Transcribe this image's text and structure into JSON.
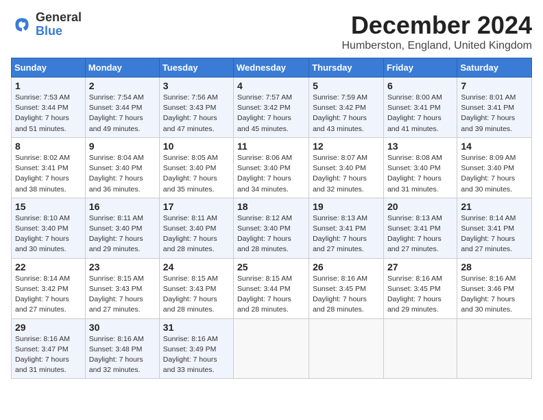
{
  "logo": {
    "general": "General",
    "blue": "Blue"
  },
  "header": {
    "month": "December 2024",
    "location": "Humberston, England, United Kingdom"
  },
  "weekdays": [
    "Sunday",
    "Monday",
    "Tuesday",
    "Wednesday",
    "Thursday",
    "Friday",
    "Saturday"
  ],
  "weeks": [
    [
      {
        "day": "1",
        "sunrise": "Sunrise: 7:53 AM",
        "sunset": "Sunset: 3:44 PM",
        "daylight": "Daylight: 7 hours and 51 minutes."
      },
      {
        "day": "2",
        "sunrise": "Sunrise: 7:54 AM",
        "sunset": "Sunset: 3:44 PM",
        "daylight": "Daylight: 7 hours and 49 minutes."
      },
      {
        "day": "3",
        "sunrise": "Sunrise: 7:56 AM",
        "sunset": "Sunset: 3:43 PM",
        "daylight": "Daylight: 7 hours and 47 minutes."
      },
      {
        "day": "4",
        "sunrise": "Sunrise: 7:57 AM",
        "sunset": "Sunset: 3:42 PM",
        "daylight": "Daylight: 7 hours and 45 minutes."
      },
      {
        "day": "5",
        "sunrise": "Sunrise: 7:59 AM",
        "sunset": "Sunset: 3:42 PM",
        "daylight": "Daylight: 7 hours and 43 minutes."
      },
      {
        "day": "6",
        "sunrise": "Sunrise: 8:00 AM",
        "sunset": "Sunset: 3:41 PM",
        "daylight": "Daylight: 7 hours and 41 minutes."
      },
      {
        "day": "7",
        "sunrise": "Sunrise: 8:01 AM",
        "sunset": "Sunset: 3:41 PM",
        "daylight": "Daylight: 7 hours and 39 minutes."
      }
    ],
    [
      {
        "day": "8",
        "sunrise": "Sunrise: 8:02 AM",
        "sunset": "Sunset: 3:41 PM",
        "daylight": "Daylight: 7 hours and 38 minutes."
      },
      {
        "day": "9",
        "sunrise": "Sunrise: 8:04 AM",
        "sunset": "Sunset: 3:40 PM",
        "daylight": "Daylight: 7 hours and 36 minutes."
      },
      {
        "day": "10",
        "sunrise": "Sunrise: 8:05 AM",
        "sunset": "Sunset: 3:40 PM",
        "daylight": "Daylight: 7 hours and 35 minutes."
      },
      {
        "day": "11",
        "sunrise": "Sunrise: 8:06 AM",
        "sunset": "Sunset: 3:40 PM",
        "daylight": "Daylight: 7 hours and 34 minutes."
      },
      {
        "day": "12",
        "sunrise": "Sunrise: 8:07 AM",
        "sunset": "Sunset: 3:40 PM",
        "daylight": "Daylight: 7 hours and 32 minutes."
      },
      {
        "day": "13",
        "sunrise": "Sunrise: 8:08 AM",
        "sunset": "Sunset: 3:40 PM",
        "daylight": "Daylight: 7 hours and 31 minutes."
      },
      {
        "day": "14",
        "sunrise": "Sunrise: 8:09 AM",
        "sunset": "Sunset: 3:40 PM",
        "daylight": "Daylight: 7 hours and 30 minutes."
      }
    ],
    [
      {
        "day": "15",
        "sunrise": "Sunrise: 8:10 AM",
        "sunset": "Sunset: 3:40 PM",
        "daylight": "Daylight: 7 hours and 30 minutes."
      },
      {
        "day": "16",
        "sunrise": "Sunrise: 8:11 AM",
        "sunset": "Sunset: 3:40 PM",
        "daylight": "Daylight: 7 hours and 29 minutes."
      },
      {
        "day": "17",
        "sunrise": "Sunrise: 8:11 AM",
        "sunset": "Sunset: 3:40 PM",
        "daylight": "Daylight: 7 hours and 28 minutes."
      },
      {
        "day": "18",
        "sunrise": "Sunrise: 8:12 AM",
        "sunset": "Sunset: 3:40 PM",
        "daylight": "Daylight: 7 hours and 28 minutes."
      },
      {
        "day": "19",
        "sunrise": "Sunrise: 8:13 AM",
        "sunset": "Sunset: 3:41 PM",
        "daylight": "Daylight: 7 hours and 27 minutes."
      },
      {
        "day": "20",
        "sunrise": "Sunrise: 8:13 AM",
        "sunset": "Sunset: 3:41 PM",
        "daylight": "Daylight: 7 hours and 27 minutes."
      },
      {
        "day": "21",
        "sunrise": "Sunrise: 8:14 AM",
        "sunset": "Sunset: 3:41 PM",
        "daylight": "Daylight: 7 hours and 27 minutes."
      }
    ],
    [
      {
        "day": "22",
        "sunrise": "Sunrise: 8:14 AM",
        "sunset": "Sunset: 3:42 PM",
        "daylight": "Daylight: 7 hours and 27 minutes."
      },
      {
        "day": "23",
        "sunrise": "Sunrise: 8:15 AM",
        "sunset": "Sunset: 3:43 PM",
        "daylight": "Daylight: 7 hours and 27 minutes."
      },
      {
        "day": "24",
        "sunrise": "Sunrise: 8:15 AM",
        "sunset": "Sunset: 3:43 PM",
        "daylight": "Daylight: 7 hours and 28 minutes."
      },
      {
        "day": "25",
        "sunrise": "Sunrise: 8:15 AM",
        "sunset": "Sunset: 3:44 PM",
        "daylight": "Daylight: 7 hours and 28 minutes."
      },
      {
        "day": "26",
        "sunrise": "Sunrise: 8:16 AM",
        "sunset": "Sunset: 3:45 PM",
        "daylight": "Daylight: 7 hours and 28 minutes."
      },
      {
        "day": "27",
        "sunrise": "Sunrise: 8:16 AM",
        "sunset": "Sunset: 3:45 PM",
        "daylight": "Daylight: 7 hours and 29 minutes."
      },
      {
        "day": "28",
        "sunrise": "Sunrise: 8:16 AM",
        "sunset": "Sunset: 3:46 PM",
        "daylight": "Daylight: 7 hours and 30 minutes."
      }
    ],
    [
      {
        "day": "29",
        "sunrise": "Sunrise: 8:16 AM",
        "sunset": "Sunset: 3:47 PM",
        "daylight": "Daylight: 7 hours and 31 minutes."
      },
      {
        "day": "30",
        "sunrise": "Sunrise: 8:16 AM",
        "sunset": "Sunset: 3:48 PM",
        "daylight": "Daylight: 7 hours and 32 minutes."
      },
      {
        "day": "31",
        "sunrise": "Sunrise: 8:16 AM",
        "sunset": "Sunset: 3:49 PM",
        "daylight": "Daylight: 7 hours and 33 minutes."
      },
      null,
      null,
      null,
      null
    ]
  ]
}
